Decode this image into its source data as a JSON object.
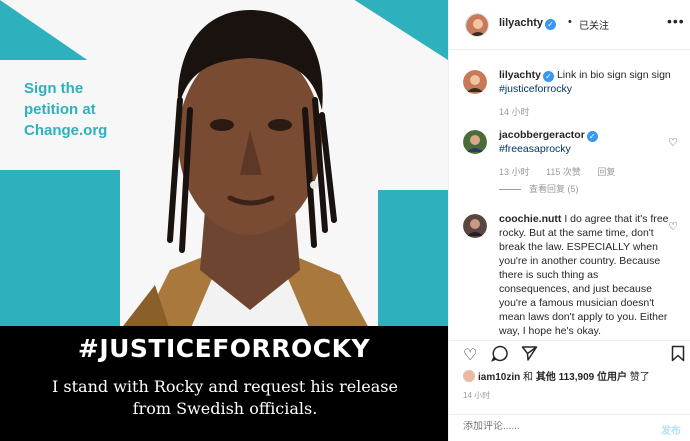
{
  "post_image": {
    "petition_text": "Sign the petition at Change.org",
    "hashtag": "#JUSTICEFORROCKY",
    "statement": "I stand with Rocky and request his release from Swedish officials."
  },
  "header": {
    "username": "lilyachty",
    "dot": "•",
    "follow_status": "已关注",
    "more": "•••"
  },
  "comments": [
    {
      "username": "lilyachty",
      "text": "Link in bio sign sign sign",
      "tag": "#justiceforrocky",
      "time": "14 小时"
    },
    {
      "username": "jacobbergeractor",
      "text": "",
      "tag": "#freeasaprocky",
      "time": "13 小时",
      "likes": "115 次赞",
      "reply": "回复",
      "view_replies": "查看回复 (5)"
    },
    {
      "username": "coochie.nutt",
      "text": "I do agree that it's free rocky. But at the same time, don't break the law. ESPECIALLY when you're in another country. Because there is such thing as consequences, and just because you're a famous musician doesn't mean laws don't apply to you. Either way, I hope he's okay."
    }
  ],
  "likes": {
    "user": "iam10zin",
    "and": "和",
    "others_prefix": "其他",
    "count": "113,909",
    "suffix": "位用户",
    "liked": "赞了",
    "time": "14 小时"
  },
  "comment_input": {
    "placeholder": "添加评论......",
    "post_label": "发布"
  }
}
